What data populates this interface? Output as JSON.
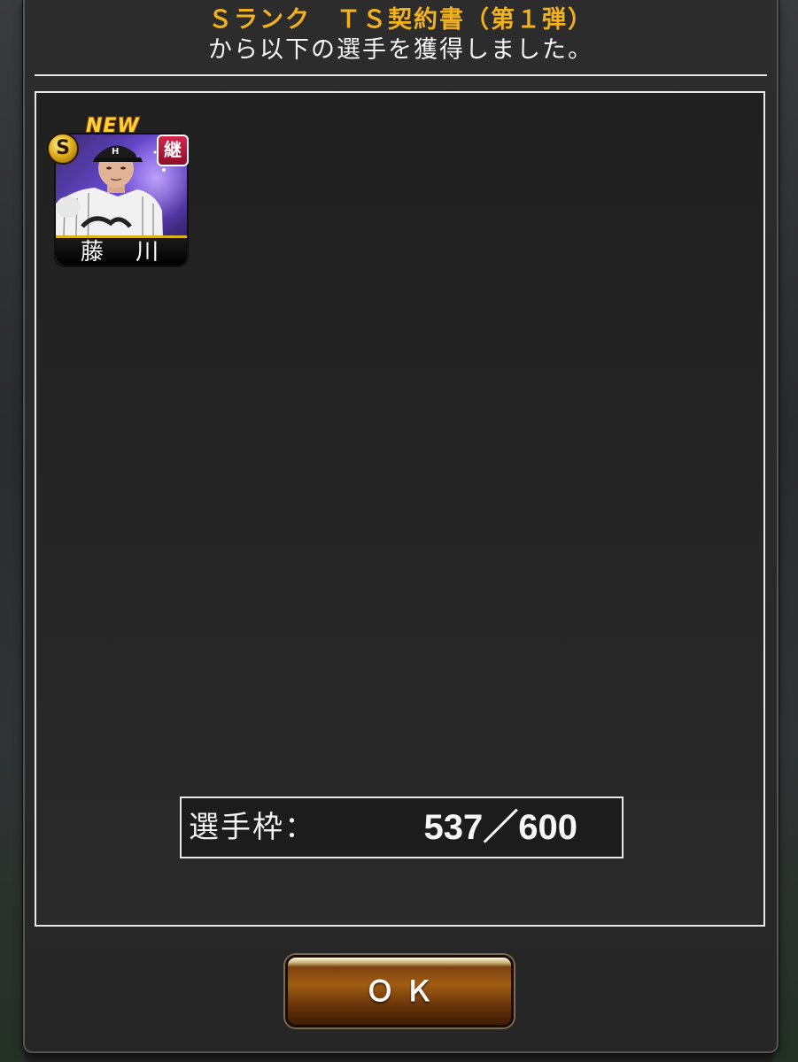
{
  "dialog": {
    "title": "Ｓランク　ＴＳ契約書（第１弾）",
    "subtitle": "から以下の選手を獲得しました。"
  },
  "player_card": {
    "new_label": "NEW",
    "rank_label": "S",
    "inherit_label": "継",
    "name": "藤 川"
  },
  "capacity": {
    "label": "選手枠：",
    "value": "537／600"
  },
  "ok_button": {
    "label": "ＯＫ"
  },
  "colors": {
    "title": "#f2b11e",
    "panel_border": "#e8e8e8",
    "button_brown": "#a15c12"
  }
}
